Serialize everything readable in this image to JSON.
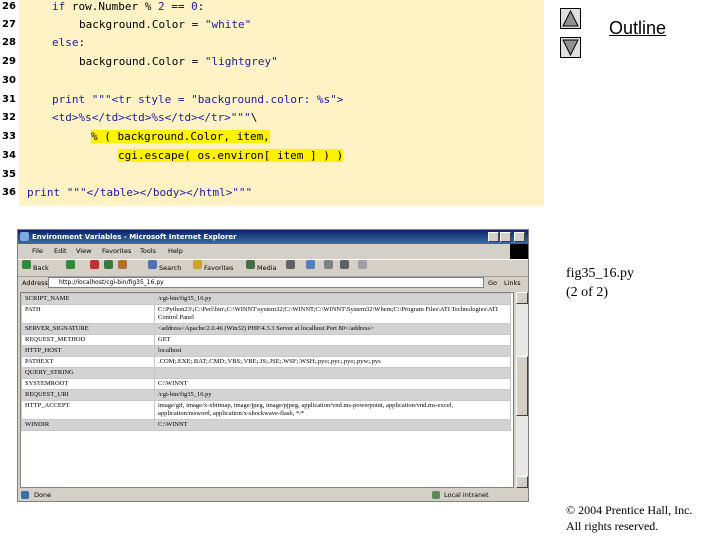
{
  "code": {
    "lines": [
      {
        "num": "26",
        "text": "if row.Number % 2 == 0:"
      },
      {
        "num": "27",
        "text": "background.Color = \"white\""
      },
      {
        "num": "28",
        "text": "else:"
      },
      {
        "num": "29",
        "text": "background.Color = \"lightgrey\""
      },
      {
        "num": "30",
        "text": ""
      },
      {
        "num": "31",
        "text": "print \"\"\"<tr style = \"background.color: %s\">"
      },
      {
        "num": "32",
        "text": "<td>%s</td><td>%s</td></tr>\"\"\"\\"
      },
      {
        "num": "33",
        "text": "% ( background.Color, item,"
      },
      {
        "num": "34",
        "text": "cgi.escape( os.environ[ item ] ) )"
      },
      {
        "num": "35",
        "text": ""
      },
      {
        "num": "36",
        "text": "print \"\"\"</table></body></html>\"\"\""
      }
    ]
  },
  "nav": {
    "outline_label": "Outline",
    "prev_icon": "triangle-up-icon",
    "next_icon": "triangle-down-icon"
  },
  "caption": {
    "line1": "fig35_16.py",
    "line2": "(2 of 2)"
  },
  "copyright": {
    "line1": "© 2004 Prentice Hall, Inc.",
    "line2": "All rights reserved."
  },
  "browser": {
    "title": "Environment Variables - Microsoft Internet Explorer",
    "menu": [
      "File",
      "Edit",
      "View",
      "Favorites",
      "Tools",
      "Help"
    ],
    "toolbar": {
      "back": "Back",
      "search": "Search",
      "favorites": "Favorites",
      "media": "Media"
    },
    "address_label": "Address",
    "address_value": "http://localhost/cgi-bin/fig35_16.py",
    "go_label": "Go",
    "links_label": "Links",
    "status_text": "Done",
    "zone_text": "Local intranet",
    "env_rows": [
      {
        "key": "SCRIPT_NAME",
        "value": "/cgi-bin/fig35_16.py"
      },
      {
        "key": "PATH",
        "value": "C:\\Python23\\;C:\\Perl\\bin\\;C:\\WINNT\\system32;C:\\WINNT;C:\\WINNT\\System32\\Wbem;C:\\Program Files\\ATI Technologies\\ATI Control Panel"
      },
      {
        "key": "SERVER_SIGNATURE",
        "value": "<address>Apache/2.0.46 (Win32) PHP/4.3.3 Server at localhost Port 80</address>"
      },
      {
        "key": "REQUEST_METHOD",
        "value": "GET"
      },
      {
        "key": "HTTP_HOST",
        "value": "localhost"
      },
      {
        "key": "PATHEXT",
        "value": ".COM;.EXE;.BAT;.CMD;.VBS;.VBE;.JS;.JSE;.WSF;.WSH;.pyo;.pyc;.pyo;.pyw;.pys"
      },
      {
        "key": "QUERY_STRING",
        "value": ""
      },
      {
        "key": "SYSTEMROOT",
        "value": "C:\\WINNT"
      },
      {
        "key": "REQUEST_URI",
        "value": "/cgi-bin/fig35_16.py"
      },
      {
        "key": "HTTP_ACCEPT",
        "value": "image/gif, image/x-xbitmap, image/jpeg, image/pjpeg, application/vnd.ms-powerpoint, application/vnd.ms-excel, application/msword, application/x-shockwave-flash, */*"
      },
      {
        "key": "WINDIR",
        "value": "C:\\WINNT"
      }
    ]
  }
}
